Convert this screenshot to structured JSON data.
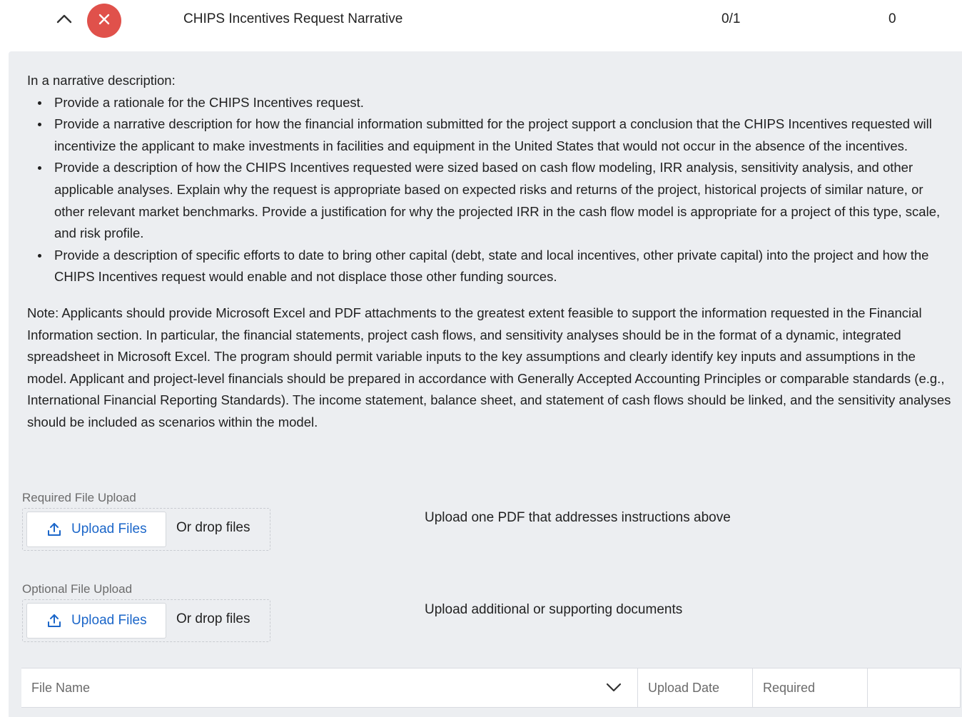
{
  "header": {
    "title": "CHIPS Incentives Request Narrative",
    "progress": "0/1",
    "count": "0",
    "status_color": "#e0514b"
  },
  "instructions": {
    "intro": "In a narrative description:",
    "bullets": [
      "Provide a rationale for the CHIPS Incentives request.",
      "Provide a narrative description for how the financial information submitted for the project support a conclusion that the CHIPS Incentives requested will incentivize the applicant to make investments in facilities and equipment in the United States that would not occur in the absence of the incentives.",
      "Provide a description of how the CHIPS Incentives requested were sized based on cash flow modeling, IRR analysis, sensitivity analysis, and other applicable analyses. Explain why the request is appropriate based on expected risks and returns of the project, historical projects of similar nature, or other relevant market benchmarks. Provide a justification for why the projected IRR in the cash flow model is appropriate for a project of this type, scale, and risk profile.",
      "Provide a description of specific efforts to date to bring other capital (debt, state and local incentives, other private capital) into the project and how the CHIPS Incentives request would enable and not displace those other funding sources."
    ],
    "note": "Note: Applicants should provide Microsoft Excel and PDF attachments to the greatest extent feasible to support the information requested in the Financial Information section. In particular, the financial statements, project cash flows, and sensitivity analyses should be in the format of a dynamic, integrated spreadsheet in Microsoft Excel. The program should permit variable inputs to the key assumptions and clearly identify key inputs and assumptions in the model. Applicant and project-level financials should be prepared in accordance with Generally Accepted Accounting Principles or comparable standards (e.g., International Financial Reporting Standards). The income statement, balance sheet, and statement of cash flows should be linked, and the sensitivity analyses should be included as scenarios within the model."
  },
  "required_upload": {
    "label": "Required File Upload",
    "button": "Upload Files",
    "drop_text": "Or drop files",
    "hint": "Upload one PDF that addresses instructions above"
  },
  "optional_upload": {
    "label": "Optional File Upload",
    "button": "Upload Files",
    "drop_text": "Or drop files",
    "hint": "Upload additional or supporting documents"
  },
  "table": {
    "columns": [
      "File Name",
      "Upload Date",
      "Required",
      ""
    ]
  },
  "colors": {
    "accent": "#1b66c9",
    "panel_bg": "#eceef1"
  }
}
